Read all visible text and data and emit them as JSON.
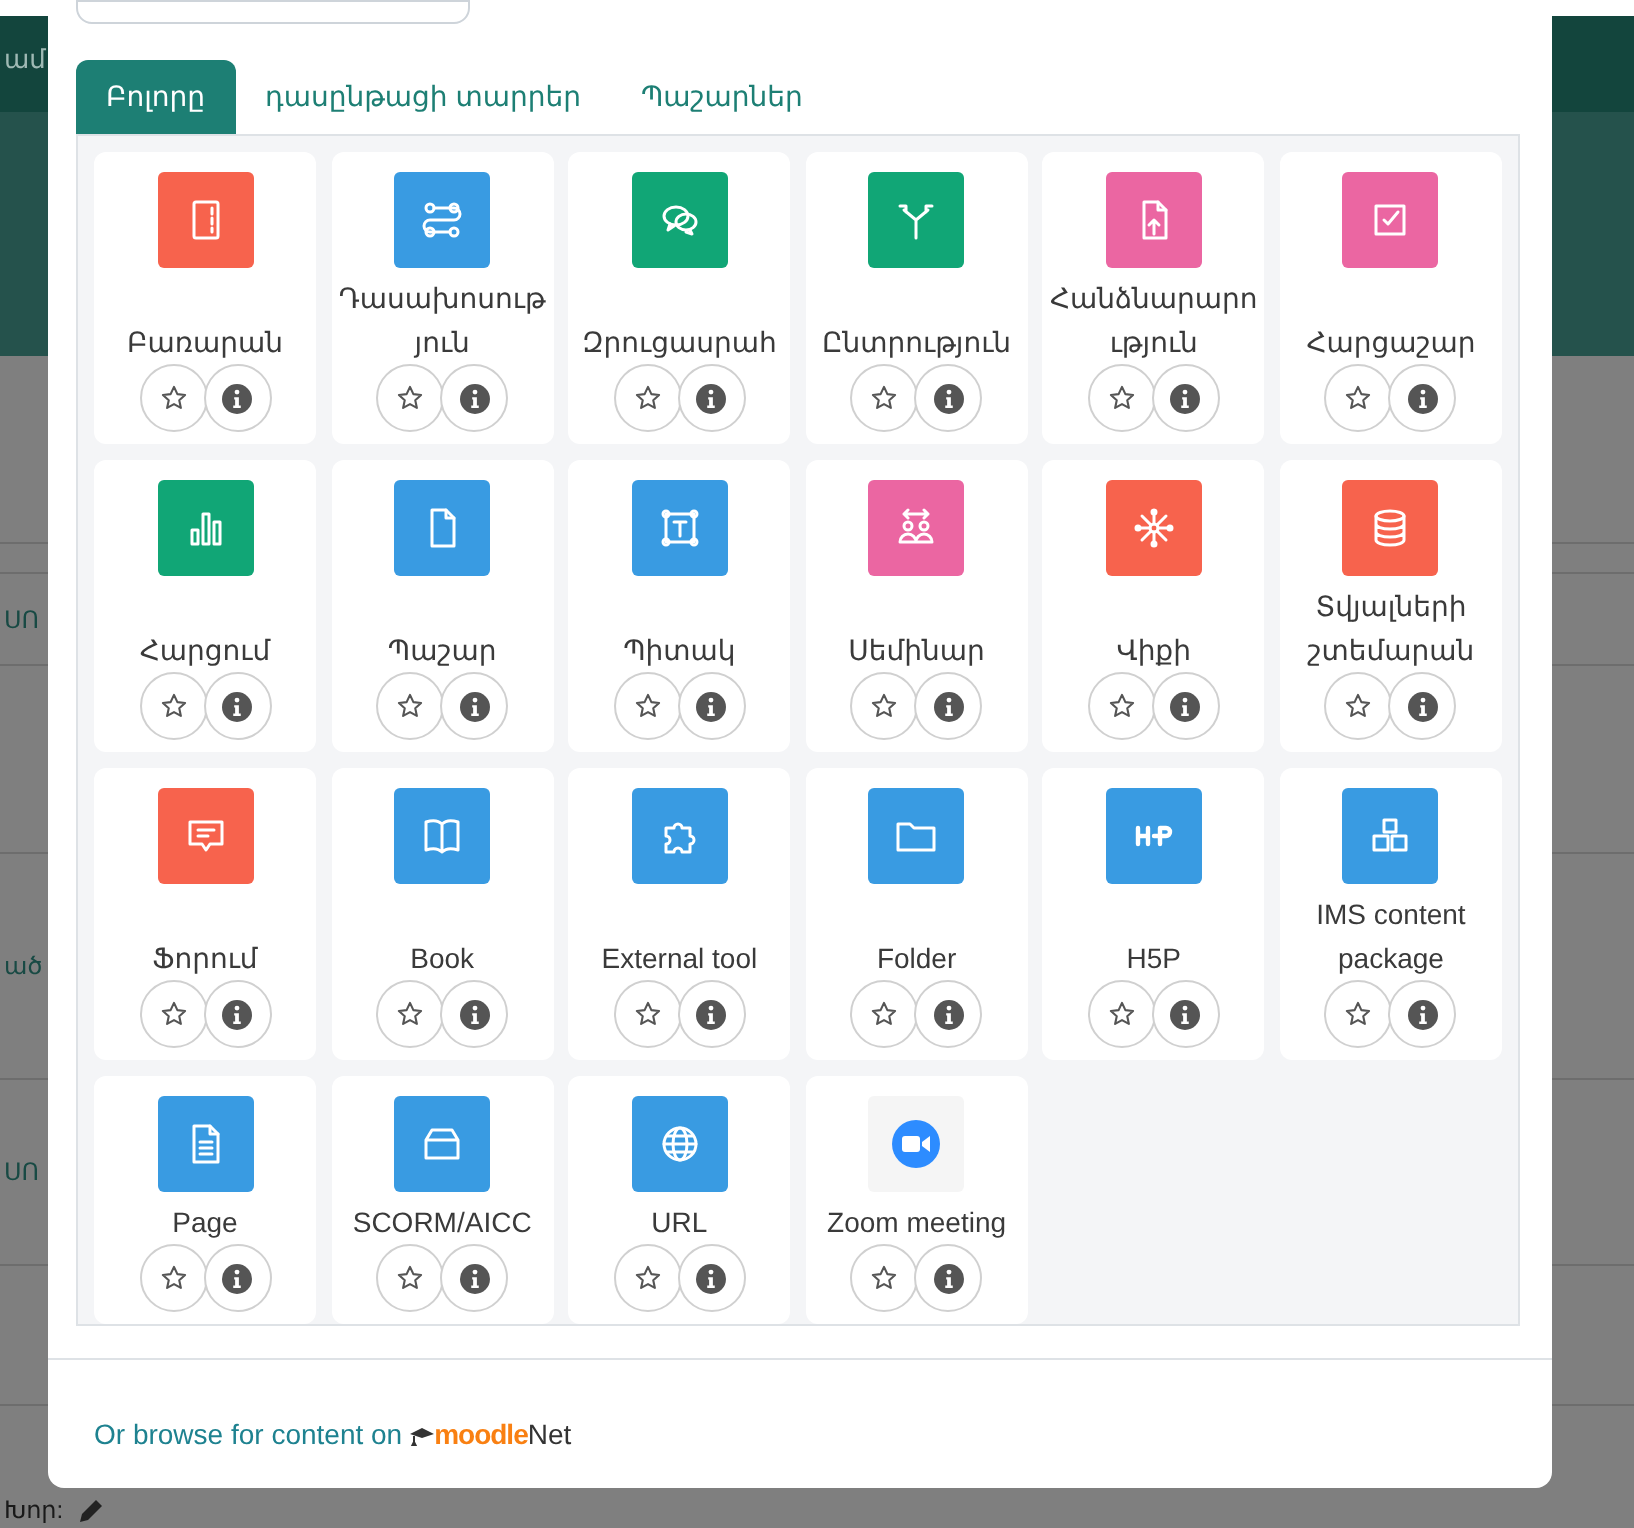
{
  "backdrop": {
    "header_fragment": "ամ",
    "fragments": [
      "ՍՈ",
      "ած",
      "ՍՈ"
    ],
    "bottom_fragment": "Խոր:"
  },
  "tabs": [
    {
      "label": "Բոլորը",
      "selected": true
    },
    {
      "label": "դասընթացի տարրեր",
      "selected": false
    },
    {
      "label": "Պաշարներ",
      "selected": false
    }
  ],
  "items": [
    {
      "name": "Բառարան",
      "kind": "glossary",
      "color": "#f7634d",
      "starred": false
    },
    {
      "name": "Դասախոսություն",
      "kind": "lesson",
      "color": "#399be2",
      "starred": false
    },
    {
      "name": "Զրուցասրահ",
      "kind": "chat",
      "color": "#11a676",
      "starred": false
    },
    {
      "name": "Ընտրություն",
      "kind": "choice",
      "color": "#11a676",
      "starred": false
    },
    {
      "name": "Հանձնարարություն",
      "kind": "assignment",
      "color": "#eb66a2",
      "starred": false
    },
    {
      "name": "Հարցաշար",
      "kind": "quiz",
      "color": "#eb66a2",
      "starred": false
    },
    {
      "name": "Հարցում",
      "kind": "survey",
      "color": "#11a676",
      "starred": false
    },
    {
      "name": "Պաշար",
      "kind": "file",
      "color": "#399be2",
      "starred": false
    },
    {
      "name": "Պիտակ",
      "kind": "label",
      "color": "#399be2",
      "starred": false
    },
    {
      "name": "Սեմինար",
      "kind": "workshop",
      "color": "#eb66a2",
      "starred": false
    },
    {
      "name": "Վիքի",
      "kind": "wiki",
      "color": "#f7634d",
      "starred": false
    },
    {
      "name": "Տվյալների շտեմարան",
      "kind": "database",
      "color": "#f7634d",
      "starred": false
    },
    {
      "name": "Ֆորում",
      "kind": "forum",
      "color": "#f7634d",
      "starred": false
    },
    {
      "name": "Book",
      "kind": "book",
      "color": "#399be2",
      "starred": false
    },
    {
      "name": "External tool",
      "kind": "puzzle",
      "color": "#399be2",
      "starred": false
    },
    {
      "name": "Folder",
      "kind": "folder",
      "color": "#399be2",
      "starred": false
    },
    {
      "name": "H5P",
      "kind": "h5p",
      "color": "#399be2",
      "starred": false
    },
    {
      "name": "IMS content package",
      "kind": "package",
      "color": "#399be2",
      "starred": false
    },
    {
      "name": "Page",
      "kind": "page",
      "color": "#399be2",
      "starred": false
    },
    {
      "name": "SCORM/AICC",
      "kind": "scorm",
      "color": "#399be2",
      "starred": false
    },
    {
      "name": "URL",
      "kind": "url",
      "color": "#399be2",
      "starred": false
    },
    {
      "name": "Zoom meeting",
      "kind": "zoom",
      "color": "#f5f5f5",
      "starred": false
    }
  ],
  "footer": {
    "text": "Or browse for content on",
    "logo_brand": "moodle",
    "logo_suffix": "Net"
  }
}
